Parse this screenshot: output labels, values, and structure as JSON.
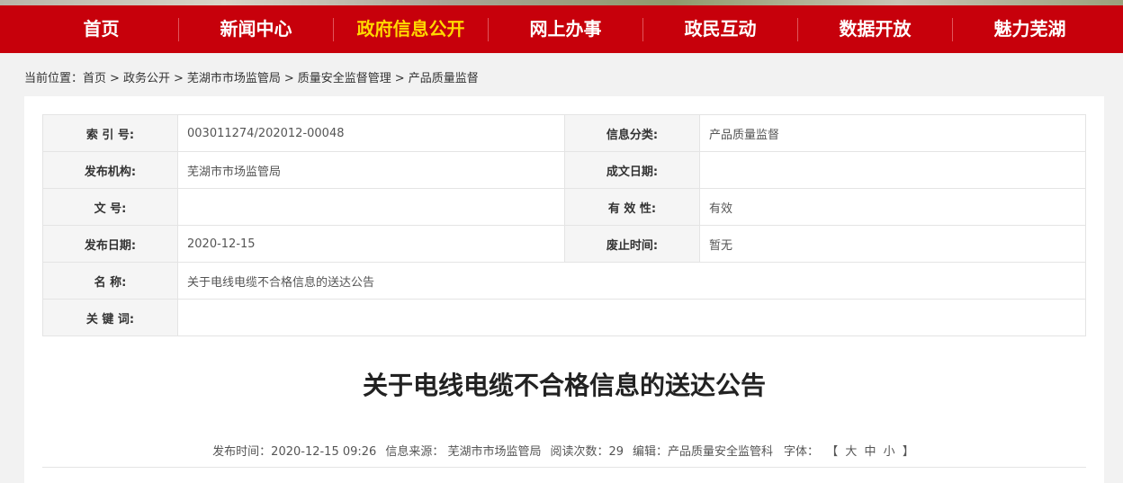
{
  "nav": {
    "items": [
      {
        "label": "首页",
        "active": false
      },
      {
        "label": "新闻中心",
        "active": false
      },
      {
        "label": "政府信息公开",
        "active": true
      },
      {
        "label": "网上办事",
        "active": false
      },
      {
        "label": "政民互动",
        "active": false
      },
      {
        "label": "数据开放",
        "active": false
      },
      {
        "label": "魅力芜湖",
        "active": false
      }
    ],
    "bg_color": "#c7000b",
    "active_color": "#ffd800"
  },
  "breadcrumb": {
    "prefix": "当前位置：",
    "items": [
      "首页",
      "政务公开",
      "芜湖市市场监管局",
      "质量安全监督管理",
      "产品质量监督"
    ],
    "separator": ">"
  },
  "meta": {
    "index_label": "索 引 号:",
    "index_value": "003011274/202012-00048",
    "category_label": "信息分类:",
    "category_value": "产品质量监督",
    "publisher_label": "发布机构:",
    "publisher_value": "芜湖市市场监管局",
    "created_label": "成文日期:",
    "created_value": "",
    "doc_no_label": "文 号:",
    "doc_no_value": "",
    "validity_label": "有 效 性:",
    "validity_value": "有效",
    "pub_date_label": "发布日期:",
    "pub_date_value": "2020-12-15",
    "abolish_label": "废止时间:",
    "abolish_value": "暂无",
    "name_label": "名 称:",
    "name_value": "关于电线电缆不合格信息的送达公告",
    "keywords_label": "关 键 词:",
    "keywords_value": ""
  },
  "article": {
    "title": "关于电线电缆不合格信息的送达公告",
    "publish_time": "发布时间：2020-12-15 09:26",
    "source": "信息来源：  芜湖市市场监管局",
    "views": "阅读次数：29",
    "editor": "编辑：产品质量安全监管科",
    "font_label": "字体：",
    "font_open": "【",
    "font_large": "大",
    "font_medium": "中",
    "font_small": "小",
    "font_close": "】"
  }
}
